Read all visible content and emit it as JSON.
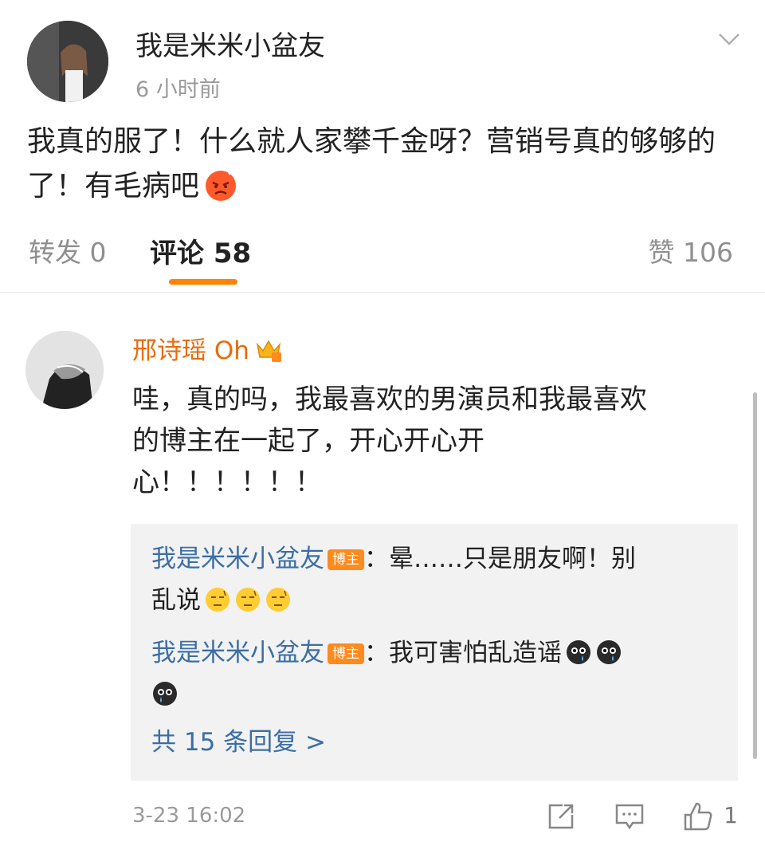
{
  "post": {
    "author": "我是米米小盆友",
    "time": "6 小时前",
    "text": "我真的服了！什么就人家攀千金呀？营销号真的够够的了！有毛病吧"
  },
  "tabs": {
    "repost": "转发 0",
    "comment": "评论 58",
    "like": "赞 106"
  },
  "comment": {
    "author": "邢诗瑶 Oh",
    "text_line1": "哇，真的吗，我最喜欢的男演员和我最喜欢",
    "text_line2": "的博主在一起了，开心开心开",
    "text_line3": "心！！！！！！",
    "time": "3-23 16:02",
    "like_count": "1",
    "replies": [
      {
        "name": "我是米米小盆友",
        "badge": "博主",
        "text1": "：晕……只是朋友啊！别",
        "text2": "乱说"
      },
      {
        "name": "我是米米小盆友",
        "badge": "博主",
        "text1": "：我可害怕乱造谣"
      }
    ],
    "more_replies": "共 15 条回复 >"
  },
  "colors": {
    "accent": "#ff8200",
    "link": "#3b6ea5",
    "vip_name": "#e86b0c"
  }
}
